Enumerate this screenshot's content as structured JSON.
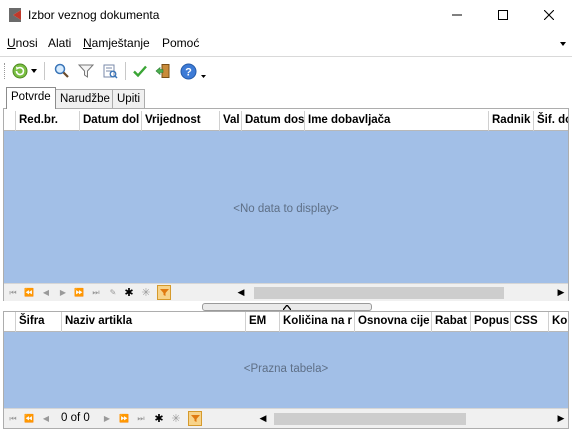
{
  "window": {
    "title": "Izbor veznog dokumenta",
    "minimize_icon": "minimize-icon",
    "maximize_icon": "maximize-icon",
    "close_icon": "close-icon"
  },
  "menu": {
    "items": [
      {
        "label": "Unosi",
        "underline": "U",
        "rest": "nosi"
      },
      {
        "label": "Alati",
        "underline": "",
        "rest": "Alati"
      },
      {
        "label": "Namještanje",
        "underline": "N",
        "rest": "amještanje"
      },
      {
        "label": "Pomoć",
        "underline": "",
        "rest": "Pomoć"
      }
    ]
  },
  "toolbar": {
    "icons": [
      "refresh-icon",
      "dropdown-arrow-icon",
      "search-icon",
      "filter-icon",
      "view-icon",
      "confirm-check-icon",
      "exit-door-icon",
      "help-icon"
    ]
  },
  "tabs": [
    {
      "label": "Potvrde",
      "active": true
    },
    {
      "label": "Narudžbe",
      "active": false
    },
    {
      "label": "Upiti",
      "active": false
    }
  ],
  "top_grid": {
    "columns": [
      "Red.br.",
      "Datum dol",
      "Vrijednost",
      "Val",
      "Datum dos",
      "Ime dobavljača",
      "Radnik",
      "Šif. do"
    ],
    "empty_text": "<No data to display>"
  },
  "bottom_grid": {
    "columns": [
      "Šifra",
      "Naziv artikla",
      "EM",
      "Količina na r",
      "Osnovna cije",
      "Rabat",
      "Popus",
      "CSS",
      "Ko"
    ],
    "empty_text": "<Prazna tabela>",
    "record_count": "0 of 0"
  },
  "colors": {
    "grid_background": "#a2bfe7",
    "empty_text": "#5e6f86"
  }
}
